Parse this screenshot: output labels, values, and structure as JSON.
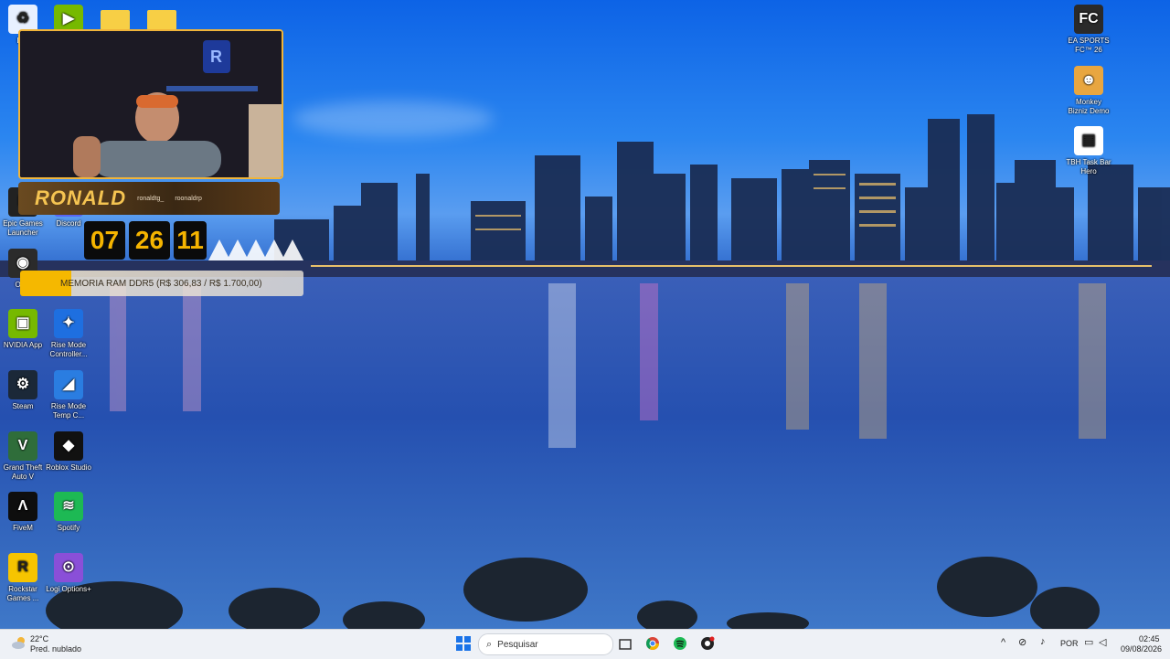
{
  "desktop_left_icons": [
    {
      "id": "recycle",
      "label": "Li...",
      "color": "#e8f0ff",
      "glyph": "♻"
    },
    {
      "id": "nvidia-top",
      "label": "",
      "color": "#76b900",
      "glyph": "▶"
    },
    {
      "id": "folder1",
      "label": "",
      "color": "#f7cf45",
      "glyph": ""
    },
    {
      "id": "folder2",
      "label": "",
      "color": "#f7cf45",
      "glyph": ""
    },
    {
      "id": "epic",
      "label": "Epic Games Launcher",
      "color": "#222222",
      "glyph": "E"
    },
    {
      "id": "discord",
      "label": "Discord",
      "color": "#5865f2",
      "glyph": ""
    },
    {
      "id": "obs",
      "label": "OBS",
      "color": "#2b2b2b",
      "glyph": "◉"
    },
    {
      "id": "nvidia",
      "label": "NVIDIA App",
      "color": "#76b900",
      "glyph": "▣"
    },
    {
      "id": "risemode",
      "label": "Rise Mode Controller...",
      "color": "#1e6fe0",
      "glyph": "✦"
    },
    {
      "id": "steam",
      "label": "Steam",
      "color": "#1b2838",
      "glyph": "⚙"
    },
    {
      "id": "risemodetemp",
      "label": "Rise Mode Temp C...",
      "color": "#2a7de1",
      "glyph": "◢"
    },
    {
      "id": "gta",
      "label": "Grand Theft Auto V",
      "color": "#2f6d3a",
      "glyph": "V"
    },
    {
      "id": "roblox",
      "label": "Roblox Studio",
      "color": "#111111",
      "glyph": "◆"
    },
    {
      "id": "fivem",
      "label": "FiveM",
      "color": "#0e0e0e",
      "glyph": "Λ"
    },
    {
      "id": "spotify",
      "label": "Spotify",
      "color": "#1db954",
      "glyph": "≋"
    },
    {
      "id": "rockstar",
      "label": "Rockstar Games ...",
      "color": "#f6c400",
      "glyph": "R"
    },
    {
      "id": "logi",
      "label": "Logi Options+",
      "color": "#8a4fd8",
      "glyph": "⊙"
    }
  ],
  "desktop_right_icons": [
    {
      "id": "eafc",
      "label": "EA SPORTS FC™ 26",
      "color": "#2a2a2a",
      "glyph": "FC"
    },
    {
      "id": "monkey",
      "label": "Monkey Bizniz Demo",
      "color": "#e8a640",
      "glyph": "☻"
    },
    {
      "id": "tbh",
      "label": "TBH Task Bar Hero",
      "color": "#ffffff",
      "glyph": "▤"
    }
  ],
  "overlay": {
    "streamer_name": "RONALD",
    "handle1": "ronaldtg_",
    "handle2": "roonaldrp",
    "timer": [
      "07",
      "26",
      "11"
    ],
    "ticker_text": "MEMORIA RAM DDR5 (R$ 306,83 / R$ 1.700,00)",
    "goal_progress": 0.18
  },
  "taskbar": {
    "weather_temp": "22°C",
    "weather_desc": "Pred. nublado",
    "search_placeholder": "Pesquisar",
    "language": "POR",
    "time": "02:45",
    "date": "09/08/2026"
  }
}
